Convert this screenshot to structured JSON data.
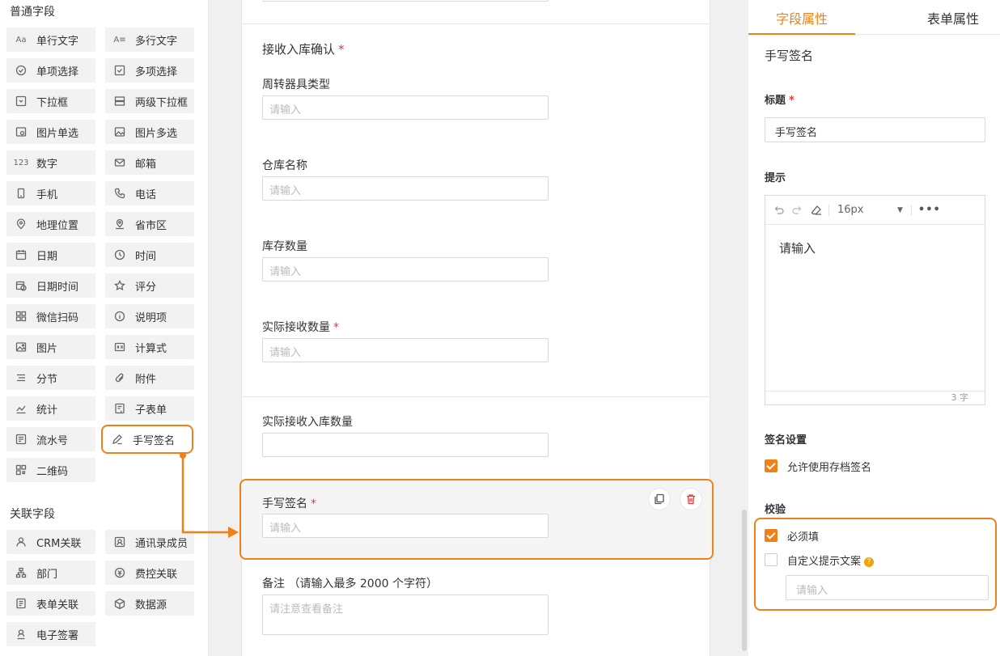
{
  "palette": {
    "basic_title": "普通字段",
    "basic_fields": [
      {
        "label": "单行文字",
        "icon": "text-aa-icon"
      },
      {
        "label": "多行文字",
        "icon": "multiline-text-icon"
      },
      {
        "label": "单项选择",
        "icon": "radio-check-icon"
      },
      {
        "label": "多项选择",
        "icon": "checkbox-icon"
      },
      {
        "label": "下拉框",
        "icon": "dropdown-icon"
      },
      {
        "label": "两级下拉框",
        "icon": "cascade-dropdown-icon"
      },
      {
        "label": "图片单选",
        "icon": "image-radio-icon"
      },
      {
        "label": "图片多选",
        "icon": "image-multi-icon"
      },
      {
        "label": "数字",
        "icon": "number-icon"
      },
      {
        "label": "邮箱",
        "icon": "mail-icon"
      },
      {
        "label": "手机",
        "icon": "mobile-icon"
      },
      {
        "label": "电话",
        "icon": "phone-icon"
      },
      {
        "label": "地理位置",
        "icon": "location-pin-icon"
      },
      {
        "label": "省市区",
        "icon": "region-pin-icon"
      },
      {
        "label": "日期",
        "icon": "calendar-icon"
      },
      {
        "label": "时间",
        "icon": "clock-icon"
      },
      {
        "label": "日期时间",
        "icon": "datetime-icon"
      },
      {
        "label": "评分",
        "icon": "star-icon"
      },
      {
        "label": "微信扫码",
        "icon": "qr-scan-icon"
      },
      {
        "label": "说明项",
        "icon": "info-icon"
      },
      {
        "label": "图片",
        "icon": "image-icon"
      },
      {
        "label": "计算式",
        "icon": "formula-icon"
      },
      {
        "label": "分节",
        "icon": "section-icon"
      },
      {
        "label": "附件",
        "icon": "attachment-icon"
      },
      {
        "label": "统计",
        "icon": "chart-line-icon"
      },
      {
        "label": "子表单",
        "icon": "subform-icon"
      },
      {
        "label": "流水号",
        "icon": "serial-number-icon"
      },
      {
        "label": "手写签名",
        "icon": "pen-icon"
      },
      {
        "label": "二维码",
        "icon": "qrcode-icon"
      }
    ],
    "related_title": "关联字段",
    "related_fields": [
      {
        "label": "CRM关联",
        "icon": "crm-link-icon"
      },
      {
        "label": "通讯录成员",
        "icon": "contact-member-icon"
      },
      {
        "label": "部门",
        "icon": "org-tree-icon"
      },
      {
        "label": "费控关联",
        "icon": "expense-link-icon"
      },
      {
        "label": "表单关联",
        "icon": "form-link-icon"
      },
      {
        "label": "数据源",
        "icon": "cube-icon"
      },
      {
        "label": "电子签署",
        "icon": "e-sign-icon"
      }
    ]
  },
  "canvas": {
    "group_title": "接收入库确认",
    "fields": [
      {
        "label": "周转器具类型",
        "placeholder": "请输入"
      },
      {
        "label": "仓库名称",
        "placeholder": "请输入"
      },
      {
        "label": "库存数量",
        "placeholder": "请输入"
      },
      {
        "label": "实际接收数量",
        "placeholder": "请输入"
      }
    ],
    "inbound_label": "实际接收入库数量",
    "signature": {
      "label": "手写签名",
      "placeholder": "请输入"
    },
    "remark": {
      "label": "备注 （请输入最多 2000 个字符）",
      "placeholder": "请注意查看备注"
    }
  },
  "props": {
    "tab_field": "字段属性",
    "tab_form": "表单属性",
    "field_type": "手写签名",
    "title_label": "标题",
    "title_value": "手写签名",
    "hint_label": "提示",
    "editor": {
      "font_size": "16px",
      "content": "请输入",
      "char_count": "3 字"
    },
    "signature_settings_label": "签名设置",
    "allow_saved_signature": "允许使用存档签名",
    "validation_label": "校验",
    "required_label": "必须填",
    "custom_hint_label": "自定义提示文案",
    "custom_hint_placeholder": "请输入"
  },
  "colors": {
    "accent": "#f0811a",
    "required": "#e4393c"
  }
}
